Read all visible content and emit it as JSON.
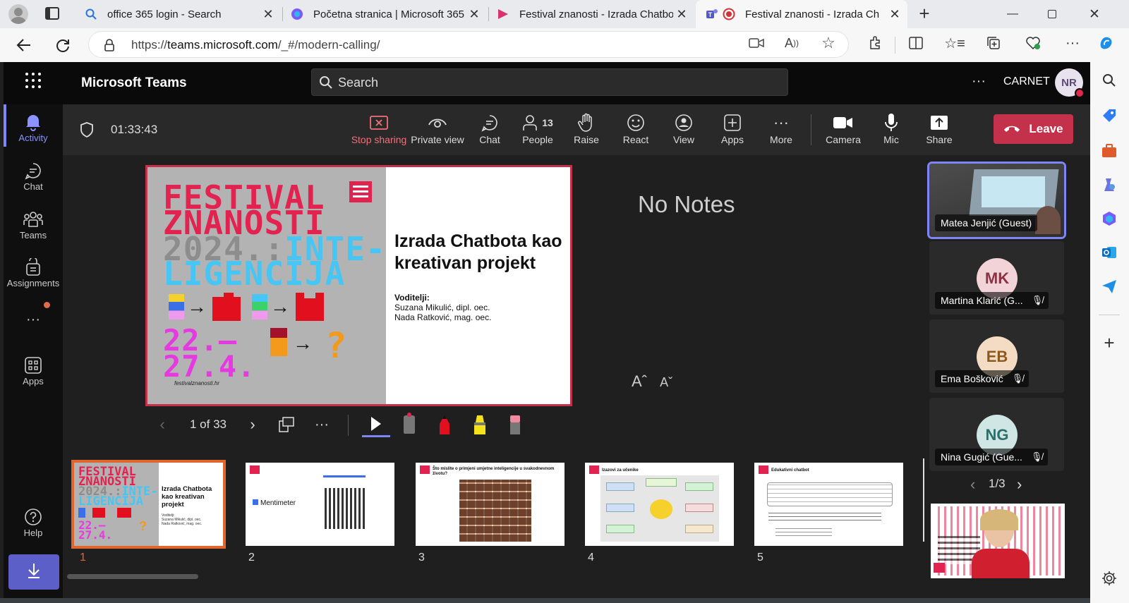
{
  "browser": {
    "tabs": [
      {
        "title": "office 365 login - Search",
        "icon": "search-icon"
      },
      {
        "title": "Početna stranica | Microsoft 365",
        "icon": "copilot-icon"
      },
      {
        "title": "Festival znanosti - Izrada Chatbota",
        "icon": "stream-icon"
      },
      {
        "title": "Festival znanosti - Izrada Ch",
        "icon": "teams-icon",
        "active": true
      }
    ],
    "url_prefix": "https://",
    "url_host": "teams.microsoft.com",
    "url_path": "/_#/modern-calling/"
  },
  "teams": {
    "app_name": "Microsoft Teams",
    "search_placeholder": "Search",
    "org": "CARNET",
    "user_initials": "NR",
    "rail": [
      {
        "label": "Activity",
        "icon": "bell-icon",
        "active": true
      },
      {
        "label": "Chat",
        "icon": "chat-icon"
      },
      {
        "label": "Teams",
        "icon": "teams-people-icon"
      },
      {
        "label": "Assignments",
        "icon": "assignments-icon"
      },
      {
        "label": "",
        "icon": "more-icon"
      },
      {
        "label": "Apps",
        "icon": "apps-icon"
      },
      {
        "label": "Help",
        "icon": "help-icon"
      }
    ]
  },
  "meeting": {
    "timer": "01:33:43",
    "controls": [
      {
        "label": "Stop sharing",
        "icon": "stop-share-icon"
      },
      {
        "label": "Private view",
        "icon": "eye-icon"
      },
      {
        "label": "Chat",
        "icon": "chat-icon"
      },
      {
        "label": "People",
        "icon": "people-icon",
        "count": "13"
      },
      {
        "label": "Raise",
        "icon": "hand-icon"
      },
      {
        "label": "React",
        "icon": "smile-icon"
      },
      {
        "label": "View",
        "icon": "view-icon"
      },
      {
        "label": "Apps",
        "icon": "plus-square-icon"
      },
      {
        "label": "More",
        "icon": "more-icon"
      },
      {
        "label": "Camera",
        "icon": "camera-icon"
      },
      {
        "label": "Mic",
        "icon": "mic-icon"
      },
      {
        "label": "Share",
        "icon": "share-icon"
      }
    ],
    "leave_label": "Leave",
    "notes": "No Notes",
    "font_increase": "Aˆ",
    "font_decrease": "Aˇ",
    "page_indicator": "1 of 33",
    "slide": {
      "festival_l1": "FESTIVAL",
      "festival_l2": "ZNANOSTI",
      "year": "2024.:",
      "inte": "INTE-",
      "ligencija": "LIGENCIJA",
      "dates_1": "22.—",
      "dates_2": "27.4.",
      "site": "festivalznanosti.hr",
      "title": "Izrada Chatbota kao kreativan projekt",
      "lead_label": "Voditelji:",
      "lead_1": "Suzana Mikulić, dipl. oec.",
      "lead_2": "Nada Ratković, mag. oec."
    },
    "thumbs": [
      {
        "num": "1",
        "selected": true
      },
      {
        "num": "2",
        "text": "Mentimeter"
      },
      {
        "num": "3",
        "text": "Što mislite o primjeni umjetne inteligencije u svakodnevnom životu?"
      },
      {
        "num": "4",
        "text": "Izazovi za učenike"
      },
      {
        "num": "5",
        "text": "Edukativni chatbot"
      }
    ],
    "participants": [
      {
        "name": "Matea Jenjić (Guest)",
        "initials": "",
        "active": true
      },
      {
        "name": "Martina Klarić (G...",
        "initials": "MK",
        "bg": "#f1d3d8",
        "fg": "#8a3344"
      },
      {
        "name": "Ema Bošković",
        "initials": "EB",
        "bg": "#f3dcc3",
        "fg": "#8a5a20"
      },
      {
        "name": "Nina Gugić (Gue...",
        "initials": "NG",
        "bg": "#cfe6e4",
        "fg": "#2d6e69"
      }
    ],
    "tile_page": "1/3"
  }
}
